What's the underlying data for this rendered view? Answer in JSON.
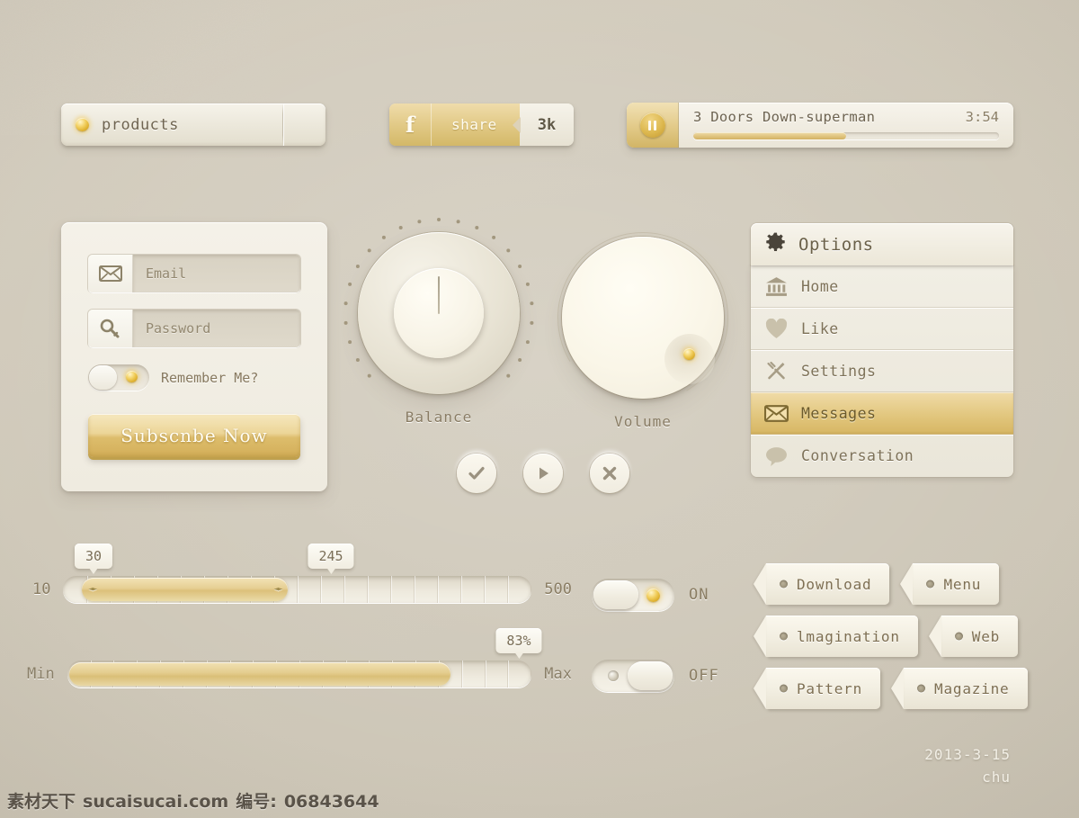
{
  "meta": {
    "background_color": "#cfc8b8",
    "accent_color": "#e0c47f",
    "text_color": "#8a7f68"
  },
  "select": {
    "value": "products",
    "led_icon": "status-led-icon",
    "caret_icon": "chevron-down-icon"
  },
  "share": {
    "brand_icon": "facebook-f-icon",
    "brand_letter": "f",
    "label": "share",
    "count": "3k"
  },
  "player": {
    "button_icon": "pause-icon",
    "title": "3 Doors Down-superman",
    "time": "3:54",
    "progress_percent": 50
  },
  "login": {
    "email": {
      "icon": "envelope-icon",
      "placeholder": "Email",
      "value": "Email"
    },
    "password": {
      "icon": "key-icon",
      "placeholder": "Password",
      "value": "Password"
    },
    "remember": {
      "label": "Remember Me?",
      "state": "on"
    },
    "submit_label": "Subscnbe Now"
  },
  "knobs": [
    {
      "name": "balance",
      "label": "Balance",
      "pointer_angle_deg": 0
    },
    {
      "name": "volume",
      "label": "Volume",
      "indicator_angle_deg": 135
    }
  ],
  "media_buttons": [
    {
      "name": "confirm",
      "icon": "check-icon",
      "glyph": "✔"
    },
    {
      "name": "play",
      "icon": "play-icon",
      "glyph": "▶"
    },
    {
      "name": "close",
      "icon": "close-x-icon",
      "glyph": "✖"
    }
  ],
  "options": {
    "header": {
      "icon": "gear-icon",
      "title": "Options",
      "caret_icon": "chevron-down-icon"
    },
    "items": [
      {
        "label": "Home",
        "icon": "bank-icon",
        "active": false
      },
      {
        "label": "Like",
        "icon": "heart-icon",
        "active": false
      },
      {
        "label": "Settings",
        "icon": "tools-icon",
        "active": false
      },
      {
        "label": "Messages",
        "icon": "envelope-icon",
        "active": true
      },
      {
        "label": "Conversation",
        "icon": "speech-bubble-icon",
        "active": false
      }
    ]
  },
  "range_slider": {
    "min_label": "10",
    "max_label": "500",
    "min": 10,
    "max": 500,
    "low_value": "30",
    "high_value": "245",
    "low_percent": 4,
    "high_percent": 48
  },
  "progress_slider": {
    "min_label": "Min",
    "max_label": "Max",
    "value_label": "83%",
    "percent": 83
  },
  "toggles": [
    {
      "name": "toggle-on",
      "state_label": "ON",
      "state": "on"
    },
    {
      "name": "toggle-off",
      "state_label": "OFF",
      "state": "off"
    }
  ],
  "tags": [
    {
      "label": "Download"
    },
    {
      "label": "Menu"
    },
    {
      "label": "lmagination"
    },
    {
      "label": "Web"
    },
    {
      "label": "Pattern"
    },
    {
      "label": "Magazine"
    }
  ],
  "signature": {
    "date": "2013-3-15",
    "author": "chu"
  },
  "watermark": {
    "site_cn": "素材天下",
    "site": "sucaisucai.com",
    "id_label": "编号:",
    "id": "06843644"
  }
}
